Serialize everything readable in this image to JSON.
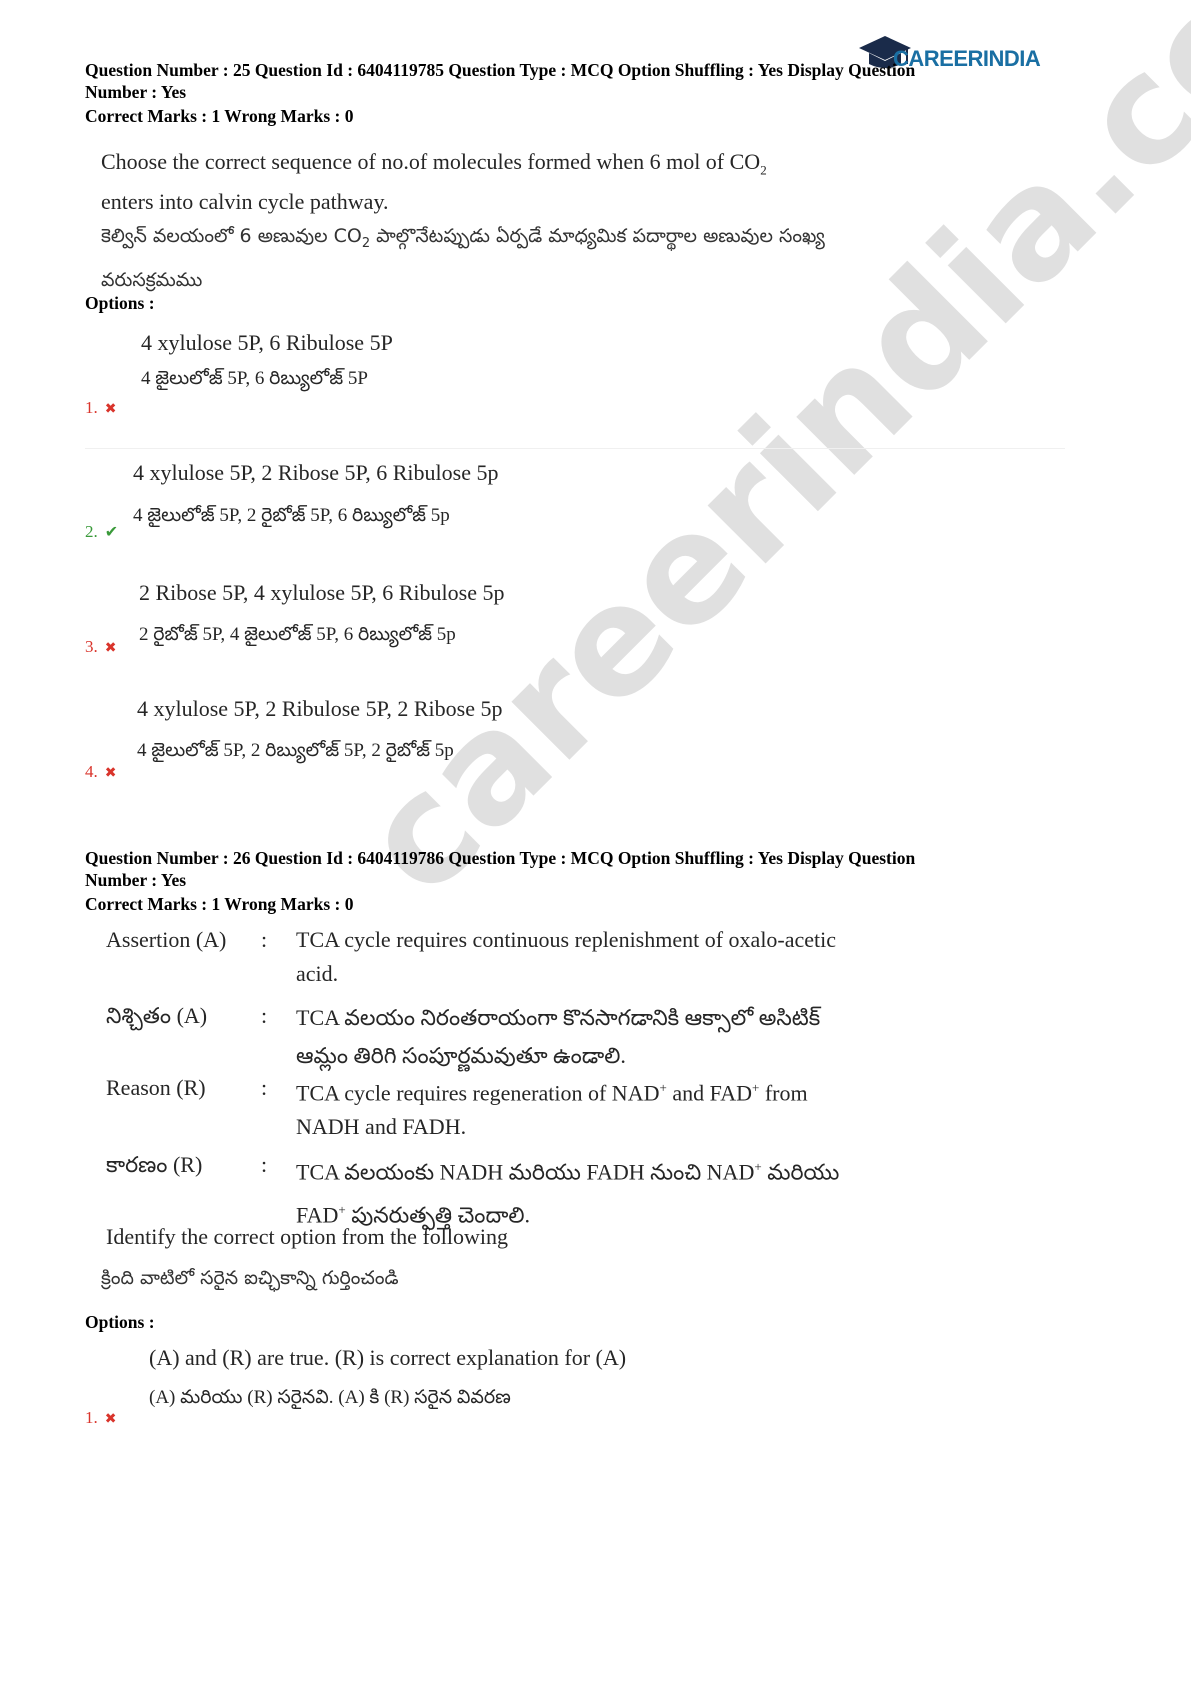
{
  "logo": {
    "text": "CAREERINDIA",
    "brand_color": "#1a6fa3"
  },
  "watermark": {
    "text": "careerindia.com"
  },
  "q25": {
    "meta_line1": "Question Number : 25 Question Id : 6404119785 Question Type : MCQ Option Shuffling : Yes Display Question",
    "meta_line2": "Number : Yes",
    "marks": "Correct Marks : 1 Wrong Marks : 0",
    "en_a": "Choose the correct sequence of no.of molecules formed when 6 mol of CO",
    "en_sub": "2",
    "en_b": "enters into calvin cycle pathway.",
    "te_a": "కెల్విన్ వలయంలో 6 అణువుల CO",
    "te_sub": "2",
    "te_b": " పాల్గొనేటప్పుడు ఏర్పడే మాధ్యమిక పదార్థాల అణువుల సంఖ్య",
    "te_c": "వరుసక్రమము",
    "options_label": "Options :",
    "options": [
      {
        "num": "1.",
        "mark": "✖",
        "en": "4 xylulose 5P, 6 Ribulose 5P",
        "te": "4 జైలులోజ్  5P, 6 రిబ్యులోజ్  5P"
      },
      {
        "num": "2.",
        "mark": "✔",
        "en": "4 xylulose 5P, 2 Ribose 5P, 6 Ribulose 5p",
        "te": "4 జైలులోజ్  5P, 2 రైబోజ్  5P, 6  రిబ్యులోజ్  5p"
      },
      {
        "num": "3.",
        "mark": "✖",
        "en": "2 Ribose 5P, 4 xylulose 5P, 6 Ribulose 5p",
        "te": "2 రైబోజ్  5P, 4 జైలులోజ్  5P, 6 రిబ్యులోజ్  5p"
      },
      {
        "num": "4.",
        "mark": "✖",
        "en": "4 xylulose 5P, 2 Ribulose 5P, 2 Ribose 5p",
        "te": "4 జైలులోజ్  5P, 2 రిబ్యులోజ్  5P, 2 రైబోజ్  5p"
      }
    ]
  },
  "q26": {
    "meta_line1": "Question Number : 26 Question Id : 6404119786 Question Type : MCQ Option Shuffling : Yes Display Question",
    "meta_line2": "Number : Yes",
    "marks": "Correct Marks : 1 Wrong Marks : 0",
    "colon": ":",
    "assertion_label": "Assertion (A)",
    "assertion_text": "TCA cycle requires continuous replenishment of oxalo-acetic acid.",
    "assertion_te_label": "నిశ్చితం (A)",
    "assertion_te_text": "TCA వలయం నిరంతరాయంగా కొనసాగడానికి ఆక్సాలో అసిటిక్ ఆమ్లం తిరిగి సంపూర్ణమవుతూ ఉండాలి.",
    "reason_label": "Reason (R)",
    "reason_a": "TCA cycle requires regeneration of NAD",
    "reason_sup1": "+",
    "reason_b": " and FAD",
    "reason_sup2": "+",
    "reason_c": " from NADH and FADH.",
    "reason_te_label": "కారణం (R)",
    "reason_te_a": "TCA వలయంకు NADH మరియు FADH నుంచి NAD",
    "reason_te_sup1": "+",
    "reason_te_b": " మరియు FAD",
    "reason_te_sup2": "+",
    "reason_te_c": " పునరుత్పత్తి చెందాలి.",
    "identify_en": "Identify the correct option from the following",
    "identify_te": "క్రింది వాటిలో సరైన ఐచ్ఛికాన్ని గుర్తించండి",
    "options_label": "Options :",
    "options": [
      {
        "num": "1.",
        "mark": "✖",
        "en": "(A) and (R) are true. (R) is correct explanation for (A)",
        "te": "(A) మరియు (R) సరైనవి. (A) కి (R) సరైన వివరణ"
      }
    ]
  }
}
